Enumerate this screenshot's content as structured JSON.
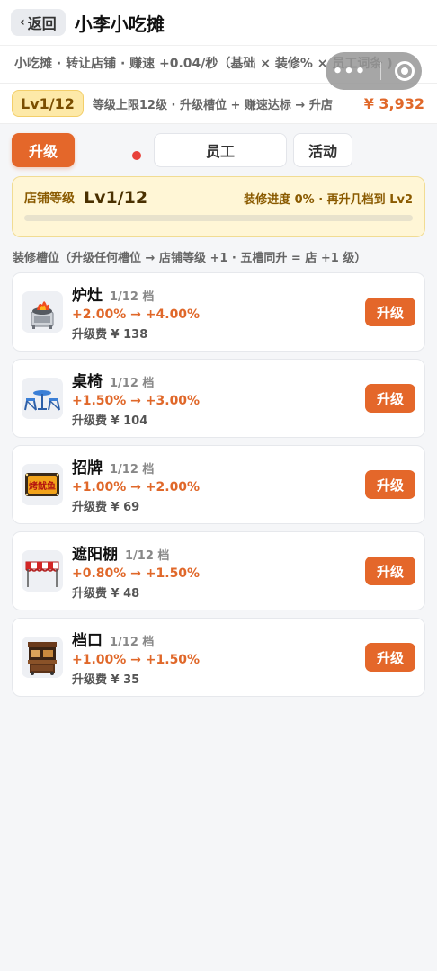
{
  "header": {
    "back_label": "返回",
    "title": "小李小吃摊"
  },
  "breadcrumb": "小吃摊 · 转让店铺 · 赚速 +0.04/秒（基础 × 装修% × 员工词条 )",
  "level_bar": {
    "badge": "Lv1/12",
    "desc": "等级上限12级 · 升级槽位 + 赚速达标 → 升店",
    "money": "¥ 3,932"
  },
  "tabs": [
    {
      "label": "升级"
    },
    {
      "label": "员工"
    },
    {
      "label": "活动"
    }
  ],
  "store": {
    "label": "店铺等级",
    "level": "Lv1/12",
    "progress_text": "装修进度 0% · 再升几档到 Lv2",
    "progress": 0
  },
  "section_hint": "装修槽位（升级任何槽位 → 店铺等级 +1 · 五槽同升 = 店 +1 级）",
  "slots": [
    {
      "name": "炉灶",
      "tier": "1/12 档",
      "rate": "+2.00% → +4.00%",
      "cost": "升级费 ¥ 138",
      "button": "升级",
      "icon": "stove-icon"
    },
    {
      "name": "桌椅",
      "tier": "1/12 档",
      "rate": "+1.50% → +3.00%",
      "cost": "升级费 ¥ 104",
      "button": "升级",
      "icon": "table-chairs-icon"
    },
    {
      "name": "招牌",
      "tier": "1/12 档",
      "rate": "+1.00% → +2.00%",
      "cost": "升级费 ¥ 69",
      "button": "升级",
      "icon": "signboard-icon",
      "sign_text": "烤鱿鱼"
    },
    {
      "name": "遮阳棚",
      "tier": "1/12 档",
      "rate": "+0.80% → +1.50%",
      "cost": "升级费 ¥ 48",
      "button": "升级",
      "icon": "awning-icon"
    },
    {
      "name": "档口",
      "tier": "1/12 档",
      "rate": "+1.00% → +1.50%",
      "cost": "升级费 ¥ 35",
      "button": "升级",
      "icon": "stall-icon"
    }
  ],
  "colors": {
    "accent": "#e4672a",
    "money": "#e0682a",
    "badge_bg": "#fde9a8",
    "card_bg": "#fff6d6",
    "red_dot": "#e8413a"
  }
}
